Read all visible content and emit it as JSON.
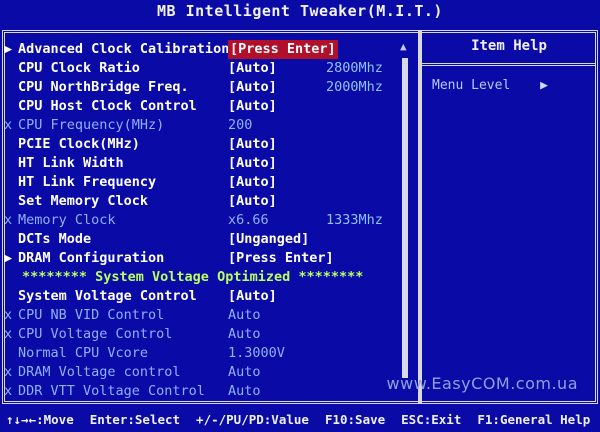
{
  "title": "MB Intelligent Tweaker(M.I.T.)",
  "help": {
    "title": "Item Help",
    "menu_level": "Menu Level",
    "menu_level_icon": "right-triangle-icon"
  },
  "rows": [
    {
      "mark": "▶",
      "label": "Advanced Clock Calibration",
      "value": "[Press Enter]",
      "freq": "",
      "style": "highlight"
    },
    {
      "mark": "",
      "label": "CPU Clock Ratio",
      "value": "[Auto]",
      "freq": "2800Mhz",
      "style": "normal"
    },
    {
      "mark": "",
      "label": "CPU NorthBridge Freq.",
      "value": "[Auto]",
      "freq": "2000Mhz",
      "style": "normal"
    },
    {
      "mark": "",
      "label": "CPU Host Clock Control",
      "value": "[Auto]",
      "freq": "",
      "style": "normal"
    },
    {
      "mark": "x",
      "label": "CPU Frequency(MHz)",
      "value": "200",
      "freq": "",
      "style": "dim"
    },
    {
      "mark": "",
      "label": "PCIE Clock(MHz)",
      "value": "[Auto]",
      "freq": "",
      "style": "normal"
    },
    {
      "mark": "",
      "label": "HT Link Width",
      "value": "[Auto]",
      "freq": "",
      "style": "normal"
    },
    {
      "mark": "",
      "label": "HT Link Frequency",
      "value": "[Auto]",
      "freq": "",
      "style": "normal"
    },
    {
      "mark": "",
      "label": "Set Memory Clock",
      "value": "[Auto]",
      "freq": "",
      "style": "normal"
    },
    {
      "mark": "x",
      "label": "Memory Clock",
      "value": "x6.66",
      "freq": "1333Mhz",
      "style": "dim"
    },
    {
      "mark": "",
      "label": "DCTs Mode",
      "value": "[Unganged]",
      "freq": "",
      "style": "normal"
    },
    {
      "mark": "▶",
      "label": "DRAM Configuration",
      "value": "[Press Enter]",
      "freq": "",
      "style": "normal"
    },
    {
      "mark": "",
      "label": "******** System Voltage Optimized ********",
      "value": "",
      "freq": "",
      "style": "section"
    },
    {
      "mark": "",
      "label": "System Voltage Control",
      "value": "[Auto]",
      "freq": "",
      "style": "normal"
    },
    {
      "mark": "x",
      "label": "CPU NB VID Control",
      "value": "Auto",
      "freq": "",
      "style": "dim"
    },
    {
      "mark": "x",
      "label": "CPU Voltage Control",
      "value": "Auto",
      "freq": "",
      "style": "dim"
    },
    {
      "mark": "",
      "label": "Normal CPU Vcore",
      "value": "1.3000V",
      "freq": "",
      "style": "dim"
    },
    {
      "mark": "x",
      "label": "DRAM Voltage control",
      "value": "Auto",
      "freq": "",
      "style": "dim"
    },
    {
      "mark": "x",
      "label": "DDR VTT Voltage Control",
      "value": "Auto",
      "freq": "",
      "style": "dim"
    }
  ],
  "scrollbar": {
    "up_arrow": "▲"
  },
  "watermark": "www.EasyCOM.com.ua",
  "footer": [
    "↑↓→←:Move",
    "Enter:Select",
    "+/-/PU/PD:Value",
    "F10:Save",
    "ESC:Exit",
    "F1:General Help"
  ],
  "colors": {
    "background": "#0a0aa6",
    "highlight": "#b0102a",
    "section": "#b8ff60",
    "dim": "#8fb0ff"
  }
}
